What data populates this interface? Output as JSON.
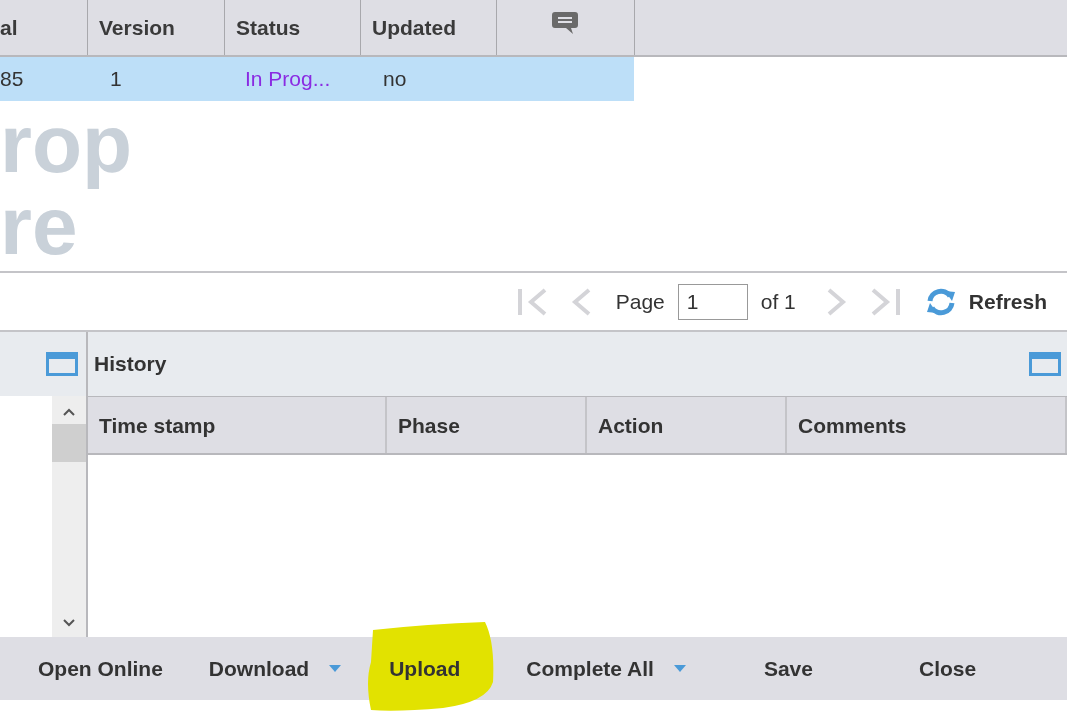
{
  "grid": {
    "columns": [
      {
        "label": "al"
      },
      {
        "label": "Version"
      },
      {
        "label": "Status"
      },
      {
        "label": "Updated"
      },
      {
        "kind": "comment"
      }
    ],
    "rows": [
      {
        "selected": true,
        "cells": [
          {
            "text": "85"
          },
          {
            "text": "1"
          },
          {
            "text": "In Prog...",
            "kind": "status"
          },
          {
            "text": "no"
          }
        ]
      }
    ],
    "drop_hint": [
      "rop",
      "re"
    ]
  },
  "pager": {
    "page_label": "Page",
    "page": "1",
    "of_label": "of 1",
    "refresh": "Refresh"
  },
  "history": {
    "title": "History",
    "columns": [
      "Time stamp",
      "Phase",
      "Action",
      "Comments"
    ]
  },
  "toolbar": [
    {
      "label": "Open Online",
      "dropdown": false,
      "highlighted": false
    },
    {
      "label": "Download",
      "dropdown": true,
      "highlighted": false
    },
    {
      "label": "Upload",
      "dropdown": false,
      "highlighted": true
    },
    {
      "label": "Complete All",
      "dropdown": true,
      "highlighted": false
    },
    {
      "label": "Save",
      "dropdown": false,
      "highlighted": false
    },
    {
      "label": "Close",
      "dropdown": false,
      "highlighted": false
    }
  ]
}
